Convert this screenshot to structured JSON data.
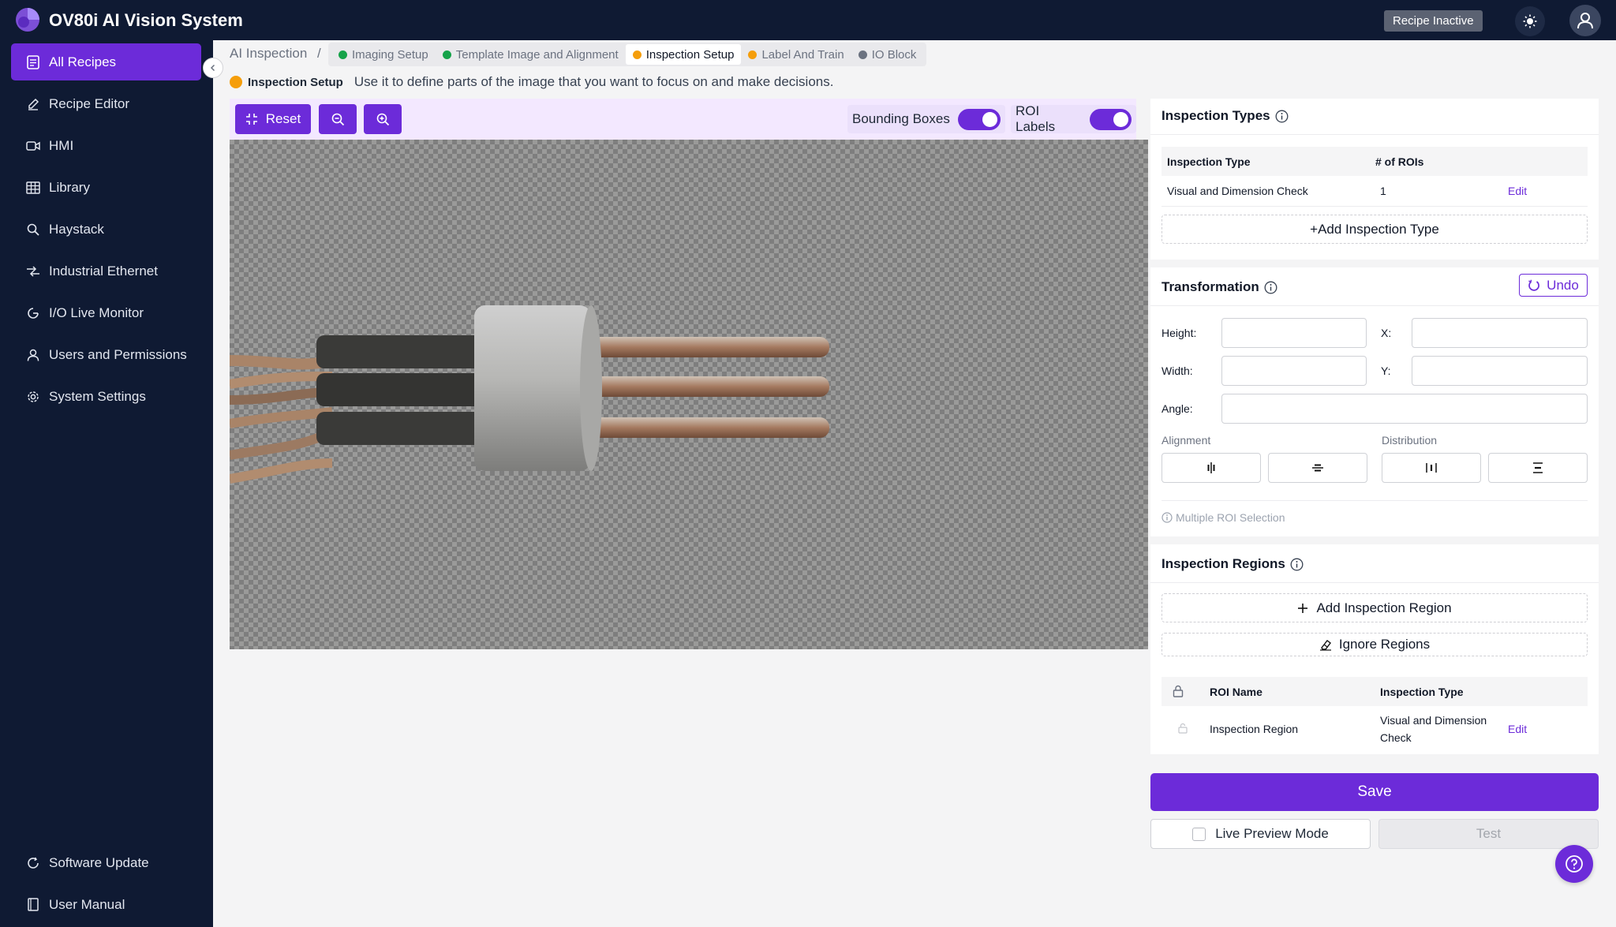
{
  "app": {
    "title": "OV80i AI Vision System",
    "recipe_status": "Recipe Inactive"
  },
  "sidebar": {
    "items": [
      {
        "label": "All Recipes",
        "icon": "recipe-list-icon",
        "active": true
      },
      {
        "label": "Recipe Editor",
        "icon": "pencil-icon"
      },
      {
        "label": "HMI",
        "icon": "camera-icon"
      },
      {
        "label": "Library",
        "icon": "table-icon"
      },
      {
        "label": "Haystack",
        "icon": "search-icon"
      },
      {
        "label": "Industrial Ethernet",
        "icon": "network-icon"
      },
      {
        "label": "I/O Live Monitor",
        "icon": "monitor-icon"
      },
      {
        "label": "Users and Permissions",
        "icon": "user-icon"
      },
      {
        "label": "System Settings",
        "icon": "gear-icon"
      }
    ],
    "bottom": [
      {
        "label": "Software Update",
        "icon": "refresh-icon"
      },
      {
        "label": "User Manual",
        "icon": "book-icon"
      }
    ]
  },
  "breadcrumb": {
    "root": "AI Inspection",
    "separator": "/",
    "tabs": [
      {
        "label": "Imaging Setup",
        "color": "#16a34a"
      },
      {
        "label": "Template Image and Alignment",
        "color": "#16a34a"
      },
      {
        "label": "Inspection Setup",
        "color": "#f59e0b",
        "active": true
      },
      {
        "label": "Label And Train",
        "color": "#f59e0b"
      },
      {
        "label": "IO Block",
        "color": "#6b7280"
      }
    ]
  },
  "step": {
    "name": "Inspection Setup",
    "description": "Use it to define parts of the image that you want to focus on and make decisions."
  },
  "toolbar": {
    "reset_label": "Reset",
    "bounding_boxes_label": "Bounding Boxes",
    "bounding_boxes_on": true,
    "roi_labels_label": "ROI Labels",
    "roi_labels_on": true
  },
  "inspection_types": {
    "title": "Inspection Types",
    "columns": [
      "Inspection Type",
      "# of ROIs"
    ],
    "rows": [
      {
        "type": "Visual and Dimension Check",
        "rois": "1",
        "action": "Edit"
      }
    ],
    "add_label": "+Add Inspection Type"
  },
  "transformation": {
    "title": "Transformation",
    "undo_label": "Undo",
    "height_label": "Height:",
    "x_label": "X:",
    "width_label": "Width:",
    "y_label": "Y:",
    "angle_label": "Angle:",
    "height_value": "",
    "x_value": "",
    "width_value": "",
    "y_value": "",
    "angle_value": "",
    "alignment_label": "Alignment",
    "distribution_label": "Distribution",
    "multi_roi_label": "Multiple ROI Selection"
  },
  "inspection_regions": {
    "title": "Inspection Regions",
    "add_label": "Add Inspection Region",
    "ignore_label": "Ignore Regions",
    "columns": [
      "ROI Name",
      "Inspection Type"
    ],
    "rows": [
      {
        "name": "Inspection Region",
        "type_line1": "Visual and Dimension",
        "type_line2": "Check",
        "action": "Edit"
      }
    ]
  },
  "actions": {
    "save_label": "Save",
    "live_preview_label": "Live Preview Mode",
    "live_preview_checked": false,
    "test_label": "Test"
  },
  "colors": {
    "accent": "#6c2bd9",
    "topbar": "#0f1a33",
    "complete": "#16a34a",
    "in_progress": "#f59e0b"
  }
}
